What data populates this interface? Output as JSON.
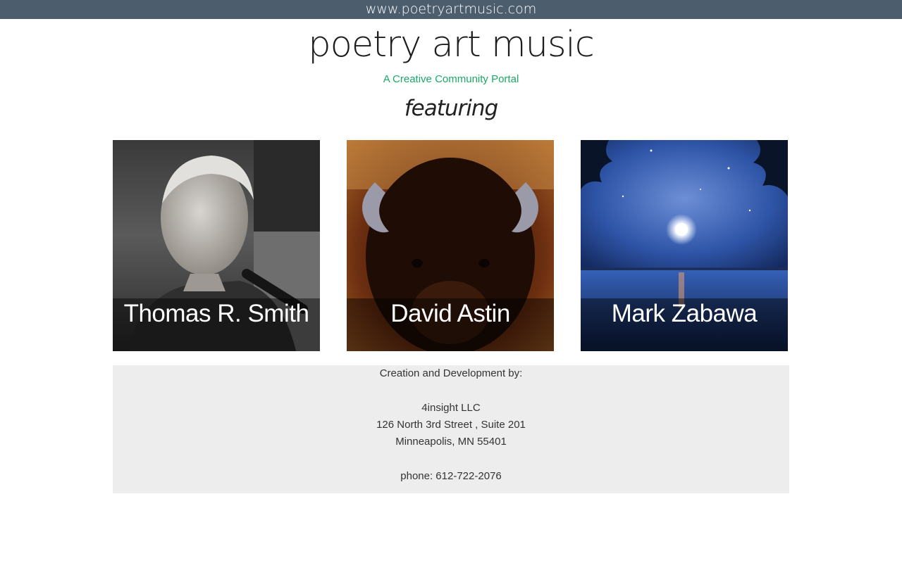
{
  "header": {
    "url_label": "www.poetryartmusic.com",
    "site_title": "poetry art music",
    "tagline": "A Creative Community Portal",
    "featuring": "featuring"
  },
  "featured": [
    {
      "name": "Thomas R. Smith",
      "icon": "portrait-photo"
    },
    {
      "name": "David Astin",
      "icon": "bison-photo"
    },
    {
      "name": "Mark Zabawa",
      "icon": "moonlit-lake-painting"
    }
  ],
  "footer": {
    "credit_heading": "Creation and Development by:",
    "company": "4insight LLC",
    "address_line1": "126 North 3rd Street , Suite 201",
    "address_line2": "Minneapolis, MN 55401",
    "phone": "phone: 612-722-2076"
  },
  "colors": {
    "topbar": "#4c5d6e",
    "tagline": "#1aa866",
    "footer_bg": "#ededed"
  }
}
